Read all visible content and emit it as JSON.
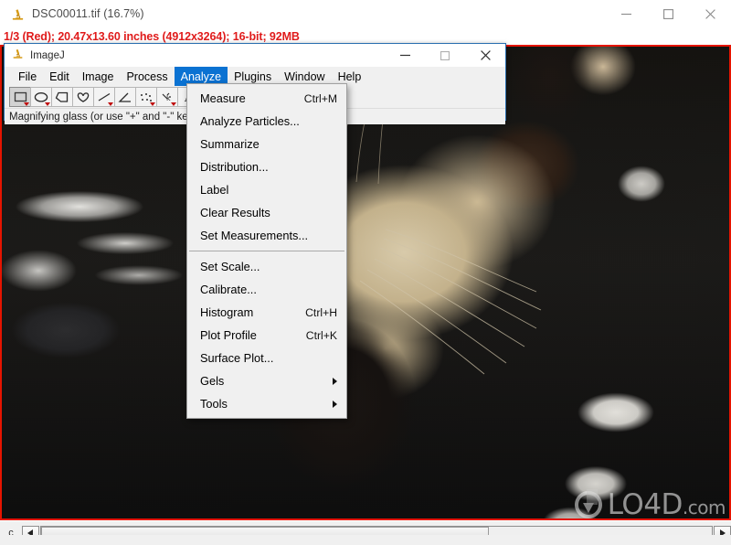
{
  "outer_window": {
    "icon": "microscope-icon",
    "title": "DSC00011.tif (16.7%)",
    "buttons": {
      "minimize": "–",
      "maximize": "□",
      "close": "×"
    }
  },
  "info_line": {
    "text": "1/3 (Red); 20.47x13.60 inches (4912x3264); 16-bit; 92MB"
  },
  "imagej_window": {
    "icon": "microscope-icon",
    "title": "ImageJ",
    "buttons": {
      "minimize": "–",
      "maximize": "□",
      "close": "×"
    },
    "menubar": [
      {
        "label": "File",
        "active": false
      },
      {
        "label": "Edit",
        "active": false
      },
      {
        "label": "Image",
        "active": false
      },
      {
        "label": "Process",
        "active": false
      },
      {
        "label": "Analyze",
        "active": true
      },
      {
        "label": "Plugins",
        "active": false
      },
      {
        "label": "Window",
        "active": false
      },
      {
        "label": "Help",
        "active": false
      }
    ],
    "toolbar": [
      {
        "name": "rectangle-tool",
        "selected": true,
        "dropdown": true
      },
      {
        "name": "oval-tool",
        "selected": false,
        "dropdown": true
      },
      {
        "name": "polygon-tool",
        "selected": false,
        "dropdown": false
      },
      {
        "name": "freehand-tool",
        "selected": false,
        "dropdown": false
      },
      {
        "name": "line-tool",
        "selected": false,
        "dropdown": true
      },
      {
        "name": "angle-tool",
        "selected": false,
        "dropdown": false
      },
      {
        "name": "point-tool",
        "selected": false,
        "dropdown": true
      },
      {
        "name": "wand-tool",
        "selected": false,
        "dropdown": true
      },
      {
        "name": "text-tool",
        "selected": false,
        "dropdown": true
      },
      {
        "name": "paintbrush-tool",
        "selected": false,
        "dropdown": false
      },
      {
        "name": "flood-fill-tool",
        "selected": false,
        "dropdown": false
      },
      {
        "name": "dropper-tool",
        "selected": false,
        "dropdown": false
      },
      {
        "name": "blank-tool-1",
        "selected": false,
        "dropdown": false
      },
      {
        "name": "blank-tool-2",
        "selected": false,
        "dropdown": false
      }
    ],
    "more_tools_label": "»",
    "status_text": "Magnifying glass (or use \"+\" and \"-\" keys)"
  },
  "analyze_menu": {
    "items": [
      {
        "label": "Measure",
        "accel": "Ctrl+M",
        "submenu": false
      },
      {
        "label": "Analyze Particles...",
        "accel": "",
        "submenu": false
      },
      {
        "label": "Summarize",
        "accel": "",
        "submenu": false
      },
      {
        "label": "Distribution...",
        "accel": "",
        "submenu": false
      },
      {
        "label": "Label",
        "accel": "",
        "submenu": false
      },
      {
        "label": "Clear Results",
        "accel": "",
        "submenu": false
      },
      {
        "label": "Set Measurements...",
        "accel": "",
        "submenu": false
      },
      {
        "separator": true
      },
      {
        "label": "Set Scale...",
        "accel": "",
        "submenu": false
      },
      {
        "label": "Calibrate...",
        "accel": "",
        "submenu": false
      },
      {
        "label": "Histogram",
        "accel": "Ctrl+H",
        "submenu": false
      },
      {
        "label": "Plot Profile",
        "accel": "Ctrl+K",
        "submenu": false
      },
      {
        "label": "Surface Plot...",
        "accel": "",
        "submenu": false
      },
      {
        "label": "Gels",
        "accel": "",
        "submenu": true
      },
      {
        "label": "Tools",
        "accel": "",
        "submenu": true
      }
    ]
  },
  "bottom_bar": {
    "channel_label": "c",
    "left_arrow": "◄",
    "right_arrow": "►"
  },
  "watermark": {
    "text": "LO4D",
    "suffix": ".com"
  },
  "colors": {
    "accent_blue": "#0b72d2",
    "info_red": "#e01b1b",
    "canvas_border_red": "#e51400",
    "window_chrome": "#f0f0f0"
  }
}
